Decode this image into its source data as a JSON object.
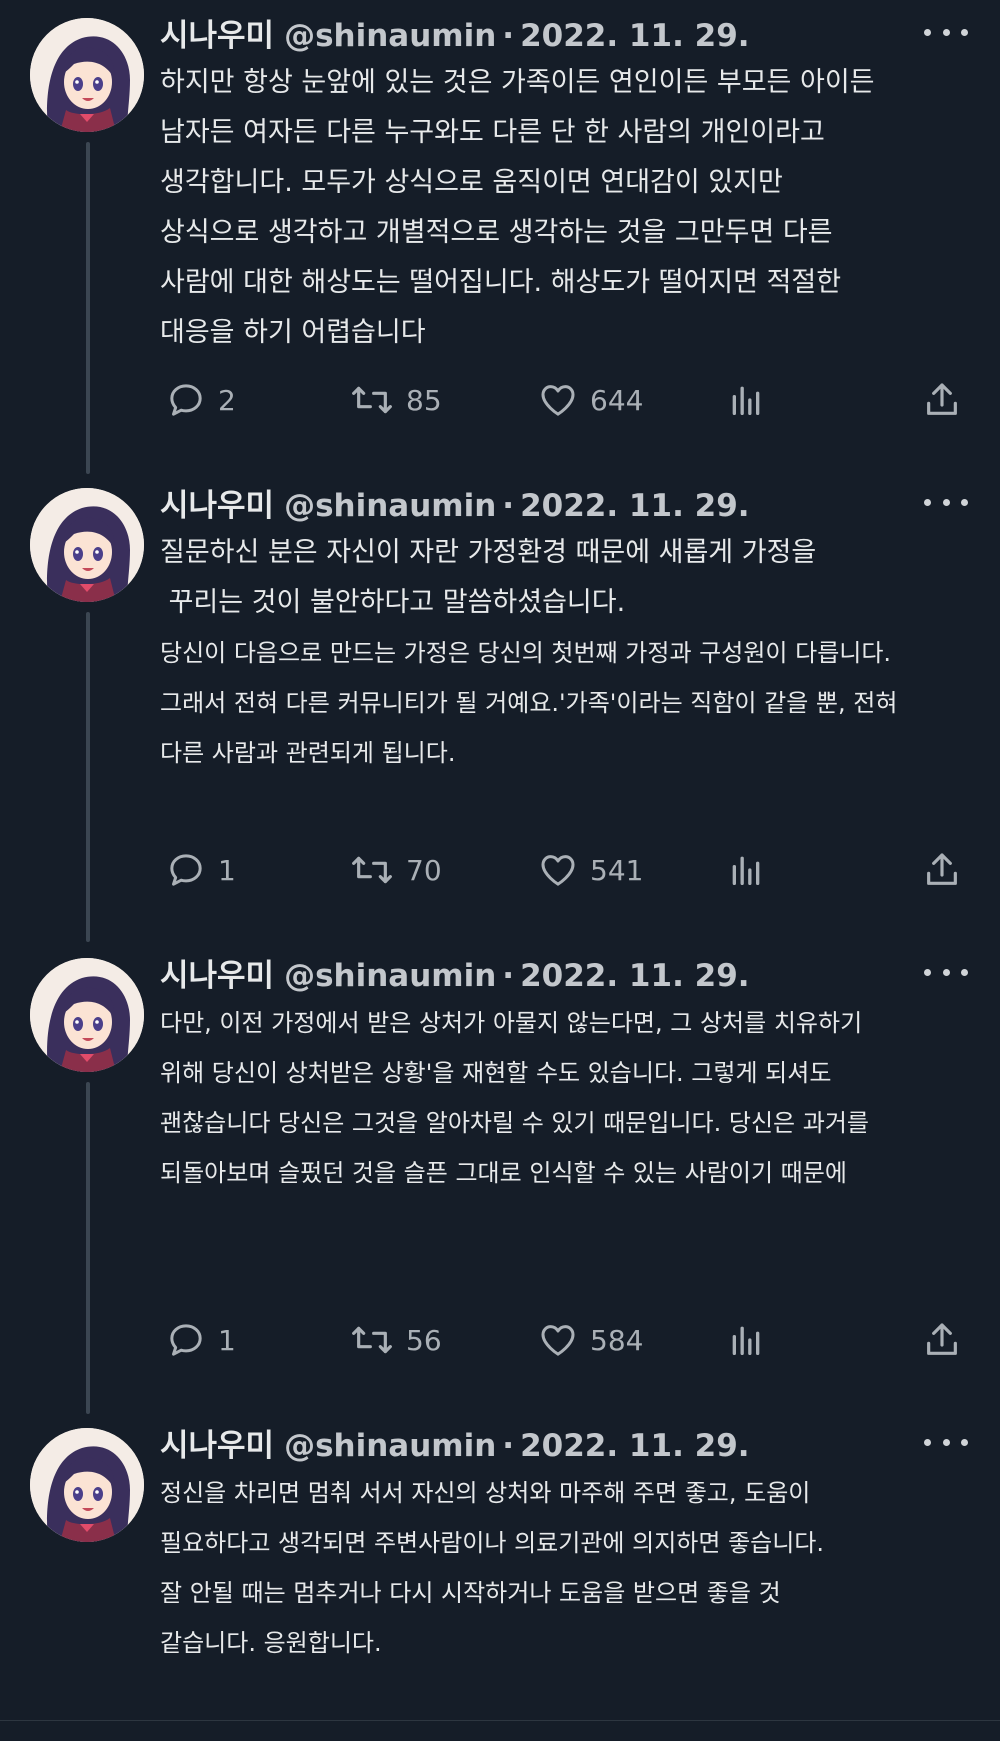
{
  "tweets": [
    {
      "name": "시나우미",
      "handle": "@shinaumin",
      "separator": "·",
      "date": "2022. 11. 29.",
      "lines": [
        "하지만 항상 눈앞에 있는 것은 가족이든 연인이든 부모든 아이든",
        "남자든 여자든 다른 누구와도 다른 단 한 사람의 개인이라고",
        "생각합니다. 모두가 상식으로 움직이면 연대감이 있지만",
        "상식으로 생각하고 개별적으로 생각하는 것을 그만두면 다른",
        "사람에 대한 해상도는 떨어집니다. 해상도가 떨어지면 적절한",
        "대응을 하기 어렵습니다"
      ],
      "replies": "2",
      "retweets": "85",
      "likes": "644"
    },
    {
      "name": "시나우미",
      "handle": "@shinaumin",
      "separator": "·",
      "date": "2022. 11. 29.",
      "lines": [
        "질문하신 분은 자신이 자란 가정환경 때문에 새롭게 가정을",
        " 꾸리는 것이 불안하다고 말씀하셨습니다.",
        "당신이 다음으로 만드는 가정은 당신의 첫번째 가정과 구성원이 다릅니다.",
        "그래서 전혀 다른 커뮤니티가 될 거예요.'가족'이라는 직함이 같을 뿐, 전혀",
        "다른 사람과 관련되게 됩니다."
      ],
      "replies": "1",
      "retweets": "70",
      "likes": "541"
    },
    {
      "name": "시나우미",
      "handle": "@shinaumin",
      "separator": "·",
      "date": "2022. 11. 29.",
      "lines": [
        "다만, 이전 가정에서 받은 상처가 아물지 않는다면, 그 상처를 치유하기",
        "위해 당신이 상처받은 상황'을 재현할 수도 있습니다. 그렇게 되셔도",
        "괜찮습니다 당신은 그것을 알아차릴 수 있기 때문입니다. 당신은 과거를",
        "되돌아보며 슬펐던 것을 슬픈 그대로 인식할 수 있는 사람이기 때문에"
      ],
      "replies": "1",
      "retweets": "56",
      "likes": "584"
    },
    {
      "name": "시나우미",
      "handle": "@shinaumin",
      "separator": "·",
      "date": "2022. 11. 29.",
      "lines": [
        "정신을 차리면 멈춰 서서 자신의 상처와 마주해 주면 좋고, 도움이",
        "필요하다고 생각되면 주변사람이나 의료기관에 의지하면 좋습니다.",
        "잘 안될 때는 멈추거나 다시 시작하거나 도움을 받으면 좋을 것",
        "같습니다. 응원합니다."
      ]
    }
  ],
  "colors": {
    "background": "#151d28",
    "text": "#e7e9ea",
    "muted": "#aab0b6",
    "thread_line": "#3b4652"
  },
  "icons": {
    "reply": "speech-bubble-icon",
    "retweet": "retweet-arrows-icon",
    "like": "heart-icon",
    "views": "bar-chart-icon",
    "share": "share-upload-icon",
    "more": "ellipsis-icon"
  }
}
